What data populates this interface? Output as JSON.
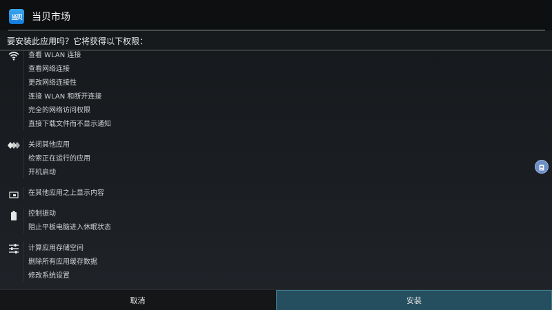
{
  "header": {
    "app_icon_text": "当贝",
    "app_name": "当贝市场"
  },
  "prompt": {
    "question": "要安装此应用吗？它将获得以下权限："
  },
  "permission_groups": [
    {
      "icon": "wifi-icon",
      "items": [
        "查看 WLAN 连接",
        "查看网络连接",
        "更改网络连接性",
        "连接 WLAN 和断开连接",
        "完全的网络访问权限",
        "直接下载文件而不显示通知"
      ]
    },
    {
      "icon": "apps-diamonds-icon",
      "items": [
        "关闭其他应用",
        "检索正在运行的应用",
        "开机启动"
      ]
    },
    {
      "icon": "overlay-window-icon",
      "items": [
        "在其他应用之上显示内容"
      ]
    },
    {
      "icon": "battery-icon",
      "items": [
        "控制振动",
        "阻止平板电脑进入休眠状态"
      ]
    },
    {
      "icon": "sliders-icon",
      "items": [
        "计算应用存储空间",
        "删除所有应用缓存数据",
        "修改系统设置"
      ]
    }
  ],
  "footer": {
    "cancel_label": "取消",
    "install_label": "安装"
  },
  "colors": {
    "install_bg": "#254e5e",
    "app_icon": "#1f8fe6"
  }
}
